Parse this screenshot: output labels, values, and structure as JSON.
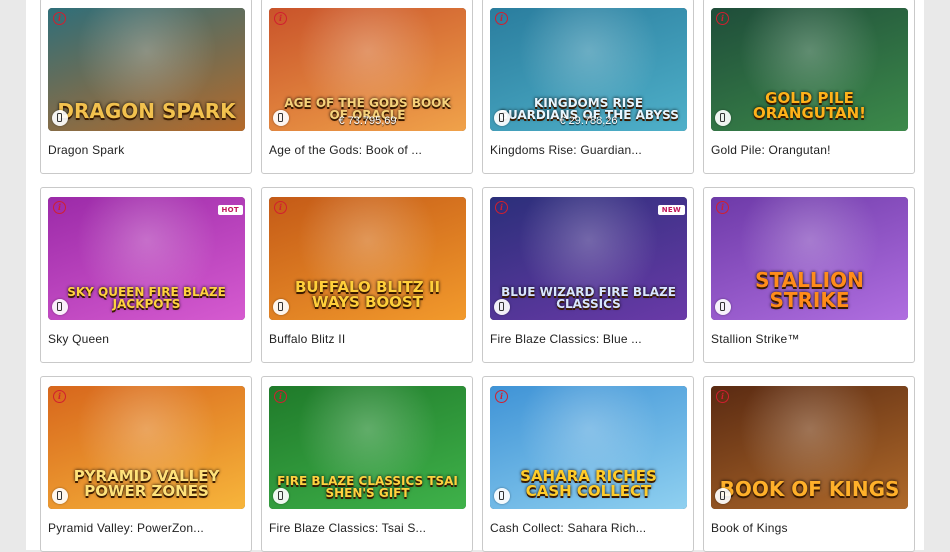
{
  "games": [
    {
      "name": "Dragon Spark",
      "art_title": "DRAGON SPARK",
      "jackpot": "",
      "badge": "",
      "colors": [
        "#2f6f7a",
        "#b56a2a"
      ],
      "title_color": "#f2c14e"
    },
    {
      "name": "Age of the Gods: Book of ...",
      "art_title": "AGE OF THE GODS BOOK OF ORACLE",
      "jackpot": "€ 73.795,69",
      "badge": "",
      "colors": [
        "#c9532a",
        "#f0a24a"
      ],
      "title_color": "#f6d27a"
    },
    {
      "name": "Kingdoms Rise: Guardian...",
      "art_title": "KINGDOMS RISE GUARDIANS OF THE ABYSS",
      "jackpot": "€ 29.788,26",
      "badge": "",
      "colors": [
        "#2a7d9e",
        "#4fb0c9"
      ],
      "title_color": "#e8f6ff"
    },
    {
      "name": "Gold Pile: Orangutan!",
      "art_title": "GOLD PILE ORANGUTAN!",
      "jackpot": "",
      "badge": "",
      "colors": [
        "#1f4d3a",
        "#3c8a4a"
      ],
      "title_color": "#ffb21a"
    },
    {
      "name": "Sky Queen",
      "art_title": "SKY QUEEN FIRE BLAZE JACKPOTS",
      "jackpot": "",
      "badge": "HOT",
      "colors": [
        "#9b2aa8",
        "#d65bd0"
      ],
      "title_color": "#ffd23f"
    },
    {
      "name": "Buffalo Blitz II",
      "art_title": "BUFFALO BLITZ II WAYS BOOST",
      "jackpot": "",
      "badge": "",
      "colors": [
        "#c45a17",
        "#f29a2c"
      ],
      "title_color": "#ffcf3a"
    },
    {
      "name": "Fire Blaze Classics: Blue ...",
      "art_title": "BLUE WIZARD FIRE BLAZE CLASSICS",
      "jackpot": "",
      "badge": "NEW",
      "colors": [
        "#2b2f7a",
        "#6a3aa8"
      ],
      "title_color": "#d8e6ff"
    },
    {
      "name": "Stallion Strike™",
      "art_title": "STALLION STRIKE",
      "jackpot": "",
      "badge": "",
      "colors": [
        "#6d3aa8",
        "#b06ee0"
      ],
      "title_color": "#ff8c1a"
    },
    {
      "name": "Pyramid Valley: PowerZon...",
      "art_title": "PYRAMID VALLEY POWER ZONES",
      "jackpot": "",
      "badge": "",
      "colors": [
        "#d7661c",
        "#f7b53b"
      ],
      "title_color": "#ffe27a"
    },
    {
      "name": "Fire Blaze Classics: Tsai S...",
      "art_title": "FIRE BLAZE CLASSICS TSAI SHEN'S GIFT",
      "jackpot": "",
      "badge": "",
      "colors": [
        "#1f7a2a",
        "#3fb24a"
      ],
      "title_color": "#ffd23f"
    },
    {
      "name": "Cash Collect: Sahara Rich...",
      "art_title": "SAHARA RICHES CASH COLLECT",
      "jackpot": "",
      "badge": "",
      "colors": [
        "#3f93d6",
        "#8fd0f0"
      ],
      "title_color": "#ffcc2a"
    },
    {
      "name": "Book of Kings",
      "art_title": "BOOK OF KINGS",
      "jackpot": "",
      "badge": "",
      "colors": [
        "#5a2a12",
        "#b06a2a"
      ],
      "title_color": "#ffb02a"
    }
  ]
}
